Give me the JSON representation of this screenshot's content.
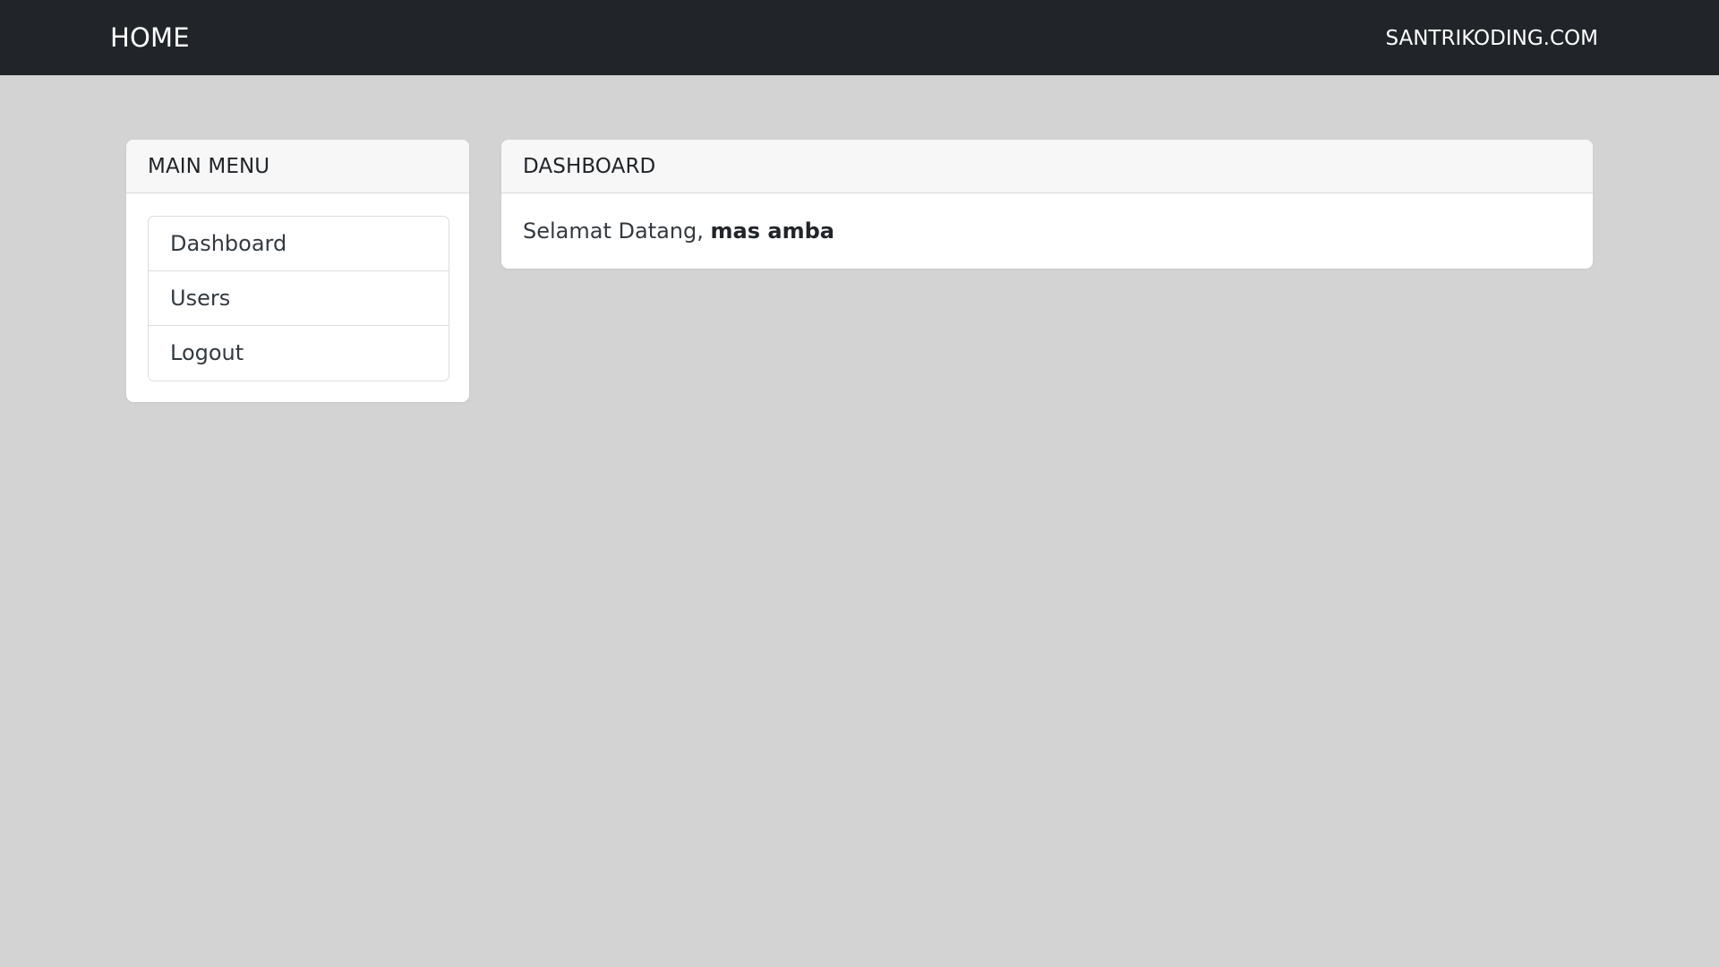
{
  "navbar": {
    "brand": "HOME",
    "right_link": "SANTRIKODING.COM",
    "background_color": "#212529"
  },
  "sidebar": {
    "title": "MAIN MENU",
    "items": [
      {
        "label": "Dashboard"
      },
      {
        "label": "Users"
      },
      {
        "label": "Logout"
      }
    ]
  },
  "dashboard": {
    "title": "DASHBOARD",
    "greeting_prefix": "Selamat Datang,",
    "user_name": "mas amba"
  },
  "colors": {
    "page_background": "#d3d3d3",
    "card_background": "#ffffff",
    "card_header_background": "#f7f7f7"
  }
}
